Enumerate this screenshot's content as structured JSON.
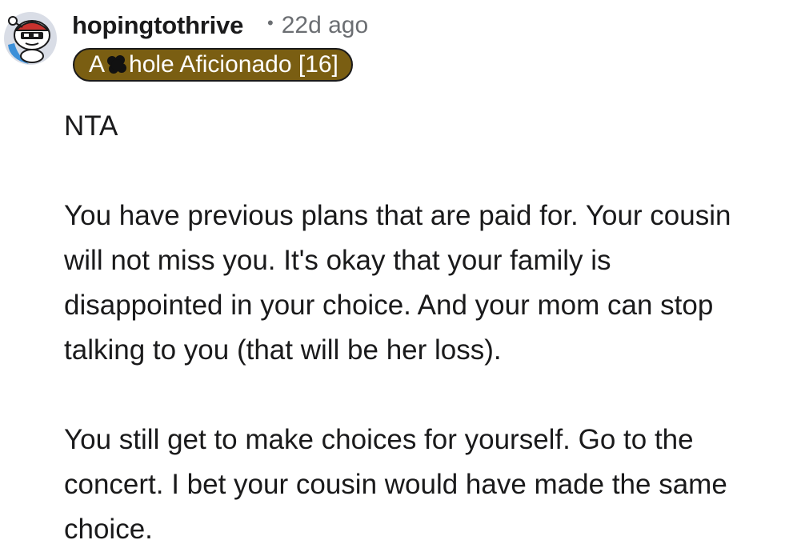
{
  "comment": {
    "author": "hopingtothrive",
    "dot": "•",
    "age": "22d ago",
    "flair": {
      "prefix": "A",
      "suffix": "hole Aficionado [16]",
      "color": "#7a5e12",
      "censor_icon": "censor-scribble-icon"
    },
    "avatar_icon": "snoo-avatar-icon",
    "paragraphs": [
      "NTA",
      "You have previous plans that are paid for. Your cousin will not miss you. It's okay that your family is disappointed in your choice. And your mom can stop talking to you (that will be her loss).",
      "You still get to make choices for yourself. Go to the concert. I bet your cousin would have made the same choice."
    ]
  }
}
